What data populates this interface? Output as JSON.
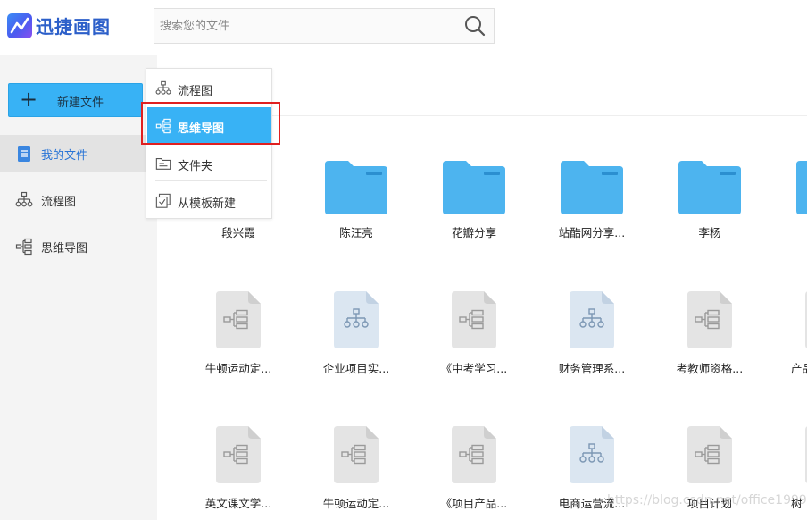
{
  "app": {
    "name": "迅捷画图"
  },
  "search": {
    "placeholder": "搜索您的文件"
  },
  "sidebar": {
    "new_button": "新建文件",
    "items": [
      {
        "label": "我的文件",
        "icon": "document-icon",
        "active": true
      },
      {
        "label": "流程图",
        "icon": "flowchart-icon",
        "active": false
      },
      {
        "label": "思维导图",
        "icon": "mindmap-icon",
        "active": false
      }
    ]
  },
  "menu": {
    "items": [
      {
        "label": "流程图",
        "icon": "flowchart-icon"
      },
      {
        "label": "思维导图",
        "icon": "mindmap-icon",
        "highlighted": true
      },
      {
        "label": "文件夹",
        "icon": "folder-outline-icon"
      },
      {
        "label": "从模板新建",
        "icon": "template-icon"
      }
    ]
  },
  "folders": [
    {
      "label": "段兴霞"
    },
    {
      "label": "陈汪亮"
    },
    {
      "label": "花瓣分享"
    },
    {
      "label": "站酷网分享..."
    },
    {
      "label": "李杨"
    },
    {
      "label": ""
    }
  ],
  "files_row1": [
    {
      "label": "牛顿运动定...",
      "kind": "mindmap"
    },
    {
      "label": "企业项目实...",
      "kind": "flowchart"
    },
    {
      "label": "《中考学习...",
      "kind": "mindmap"
    },
    {
      "label": "财务管理系...",
      "kind": "flowchart"
    },
    {
      "label": "考教师资格...",
      "kind": "mindmap"
    },
    {
      "label": "产品",
      "kind": "mindmap"
    }
  ],
  "files_row2": [
    {
      "label": "英文课文学...",
      "kind": "mindmap"
    },
    {
      "label": "牛顿运动定...",
      "kind": "mindmap"
    },
    {
      "label": "《项目产品...",
      "kind": "mindmap"
    },
    {
      "label": "电商运营流...",
      "kind": "flowchart"
    },
    {
      "label": "项目计划",
      "kind": "mindmap"
    },
    {
      "label": "树",
      "kind": "mindmap"
    }
  ],
  "watermark": "https://blog.csdn.net/office1999",
  "colors": {
    "accent": "#38b2f5",
    "folder": "#4db4ef",
    "active_text": "#2a75d6",
    "highlight_box": "#e01f1f",
    "doc_gray": "#e4e4e4",
    "doc_blue": "#dbe6f1"
  }
}
